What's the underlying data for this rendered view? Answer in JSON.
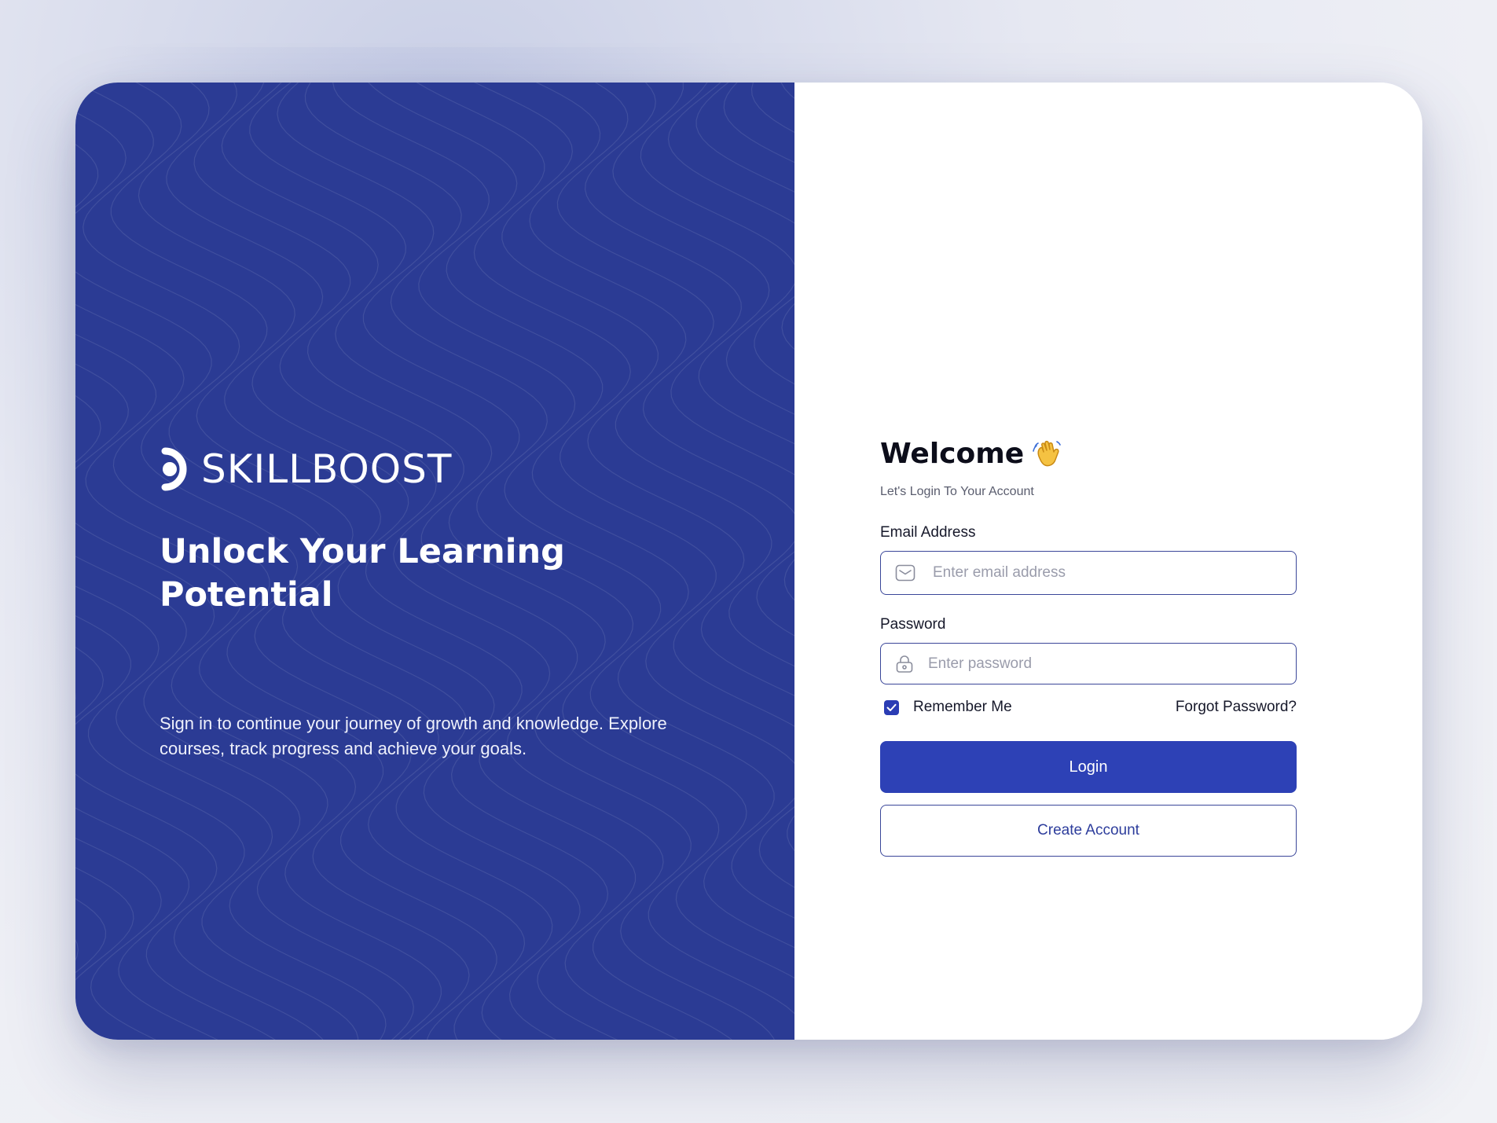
{
  "brand": {
    "name": "SKILLBOOST",
    "logo_icon": "skillboost-logo-icon"
  },
  "hero": {
    "title": "Unlock Your Learning Potential",
    "subtitle": "Sign in to continue your journey of growth and knowledge. Explore courses, track progress and achieve your goals."
  },
  "login": {
    "title": "Welcome",
    "title_icon": "waving-hand-icon",
    "subtitle": "Let's Login To Your Account",
    "email": {
      "label": "Email Address",
      "placeholder": "Enter email address",
      "value": "",
      "icon": "mail-icon"
    },
    "password": {
      "label": "Password",
      "placeholder": "Enter password",
      "value": "",
      "icon": "lock-icon"
    },
    "remember_me": {
      "label": "Remember Me",
      "checked": true
    },
    "forgot_password": "Forgot Password?",
    "login_button": "Login",
    "create_account_button": "Create Account"
  },
  "colors": {
    "brand_primary": "#2b3b94",
    "button_primary": "#2d41b6",
    "input_border": "#3a4699",
    "text_dark": "#0c0d1a",
    "placeholder": "#9a9cab"
  }
}
